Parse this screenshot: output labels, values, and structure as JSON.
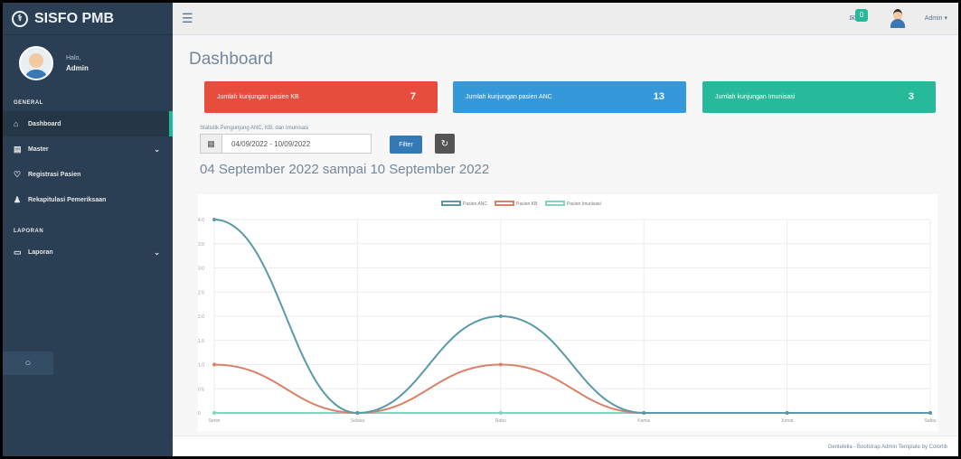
{
  "app": {
    "brand": "SISFO PMB",
    "brand_icon": "stethoscope-icon"
  },
  "profile": {
    "greeting": "Halo,",
    "name": "Admin"
  },
  "sidebar": {
    "sections": [
      {
        "title": "GENERAL",
        "items": [
          {
            "label": "Dashboard",
            "icon": "home-icon",
            "active": true,
            "has_children": false
          },
          {
            "label": "Master",
            "icon": "clipboard-icon",
            "active": false,
            "has_children": true
          },
          {
            "label": "Registrasi Pasien",
            "icon": "stethoscope-icon",
            "active": false,
            "has_children": false
          },
          {
            "label": "Rekapitulasi Pemeriksaan",
            "icon": "users-icon",
            "active": false,
            "has_children": false
          }
        ]
      },
      {
        "title": "LAPORAN",
        "items": [
          {
            "label": "Laporan",
            "icon": "laptop-icon",
            "active": false,
            "has_children": true
          }
        ]
      }
    ]
  },
  "topbar": {
    "notif_count": "0",
    "user_label": "Admin ▾"
  },
  "page": {
    "title": "Dashboard"
  },
  "cards": [
    {
      "label": "Jumlah kunjungan pasien KB",
      "value": "7",
      "color": "#e74c3c"
    },
    {
      "label": "Jumlah kunjungan pasien ANC",
      "value": "13",
      "color": "#3498db"
    },
    {
      "label": "Jumlah kunjungan Imunisasi",
      "value": "3",
      "color": "#26b99a"
    }
  ],
  "filter": {
    "label": "Statistik Pengunjung ANC, KB, dan Imunisasi",
    "date_range_value": "04/09/2022 - 10/09/2022",
    "filter_button": "Filter",
    "refresh_icon": "refresh-icon"
  },
  "range_title": "04 September 2022 sampai 10 September 2022",
  "chart_data": {
    "type": "line",
    "categories": [
      "Senin",
      "Selasa",
      "Rabu",
      "Kamis",
      "Jumat",
      "Sabtu"
    ],
    "series": [
      {
        "name": "Pasien ANC",
        "values": [
          4,
          0,
          2,
          0,
          0,
          0
        ],
        "color": "#5b9aa8"
      },
      {
        "name": "Pasien KB",
        "values": [
          1,
          0,
          1,
          0,
          0,
          0
        ],
        "color": "#d98268"
      },
      {
        "name": "Pasien Imunisasi",
        "values": [
          0,
          0,
          0,
          0,
          0,
          0
        ],
        "color": "#7fd6c1"
      }
    ],
    "ylim": [
      0,
      4
    ],
    "yticks": [
      "0",
      "0.5",
      "1.0",
      "1.5",
      "2.0",
      "2.5",
      "3.0",
      "3.5",
      "4.0"
    ],
    "legend": "top-center",
    "grid": true,
    "smooth": true
  },
  "footer": {
    "text": "Gentelella - Bootstrap Admin Template by Colorlib"
  }
}
